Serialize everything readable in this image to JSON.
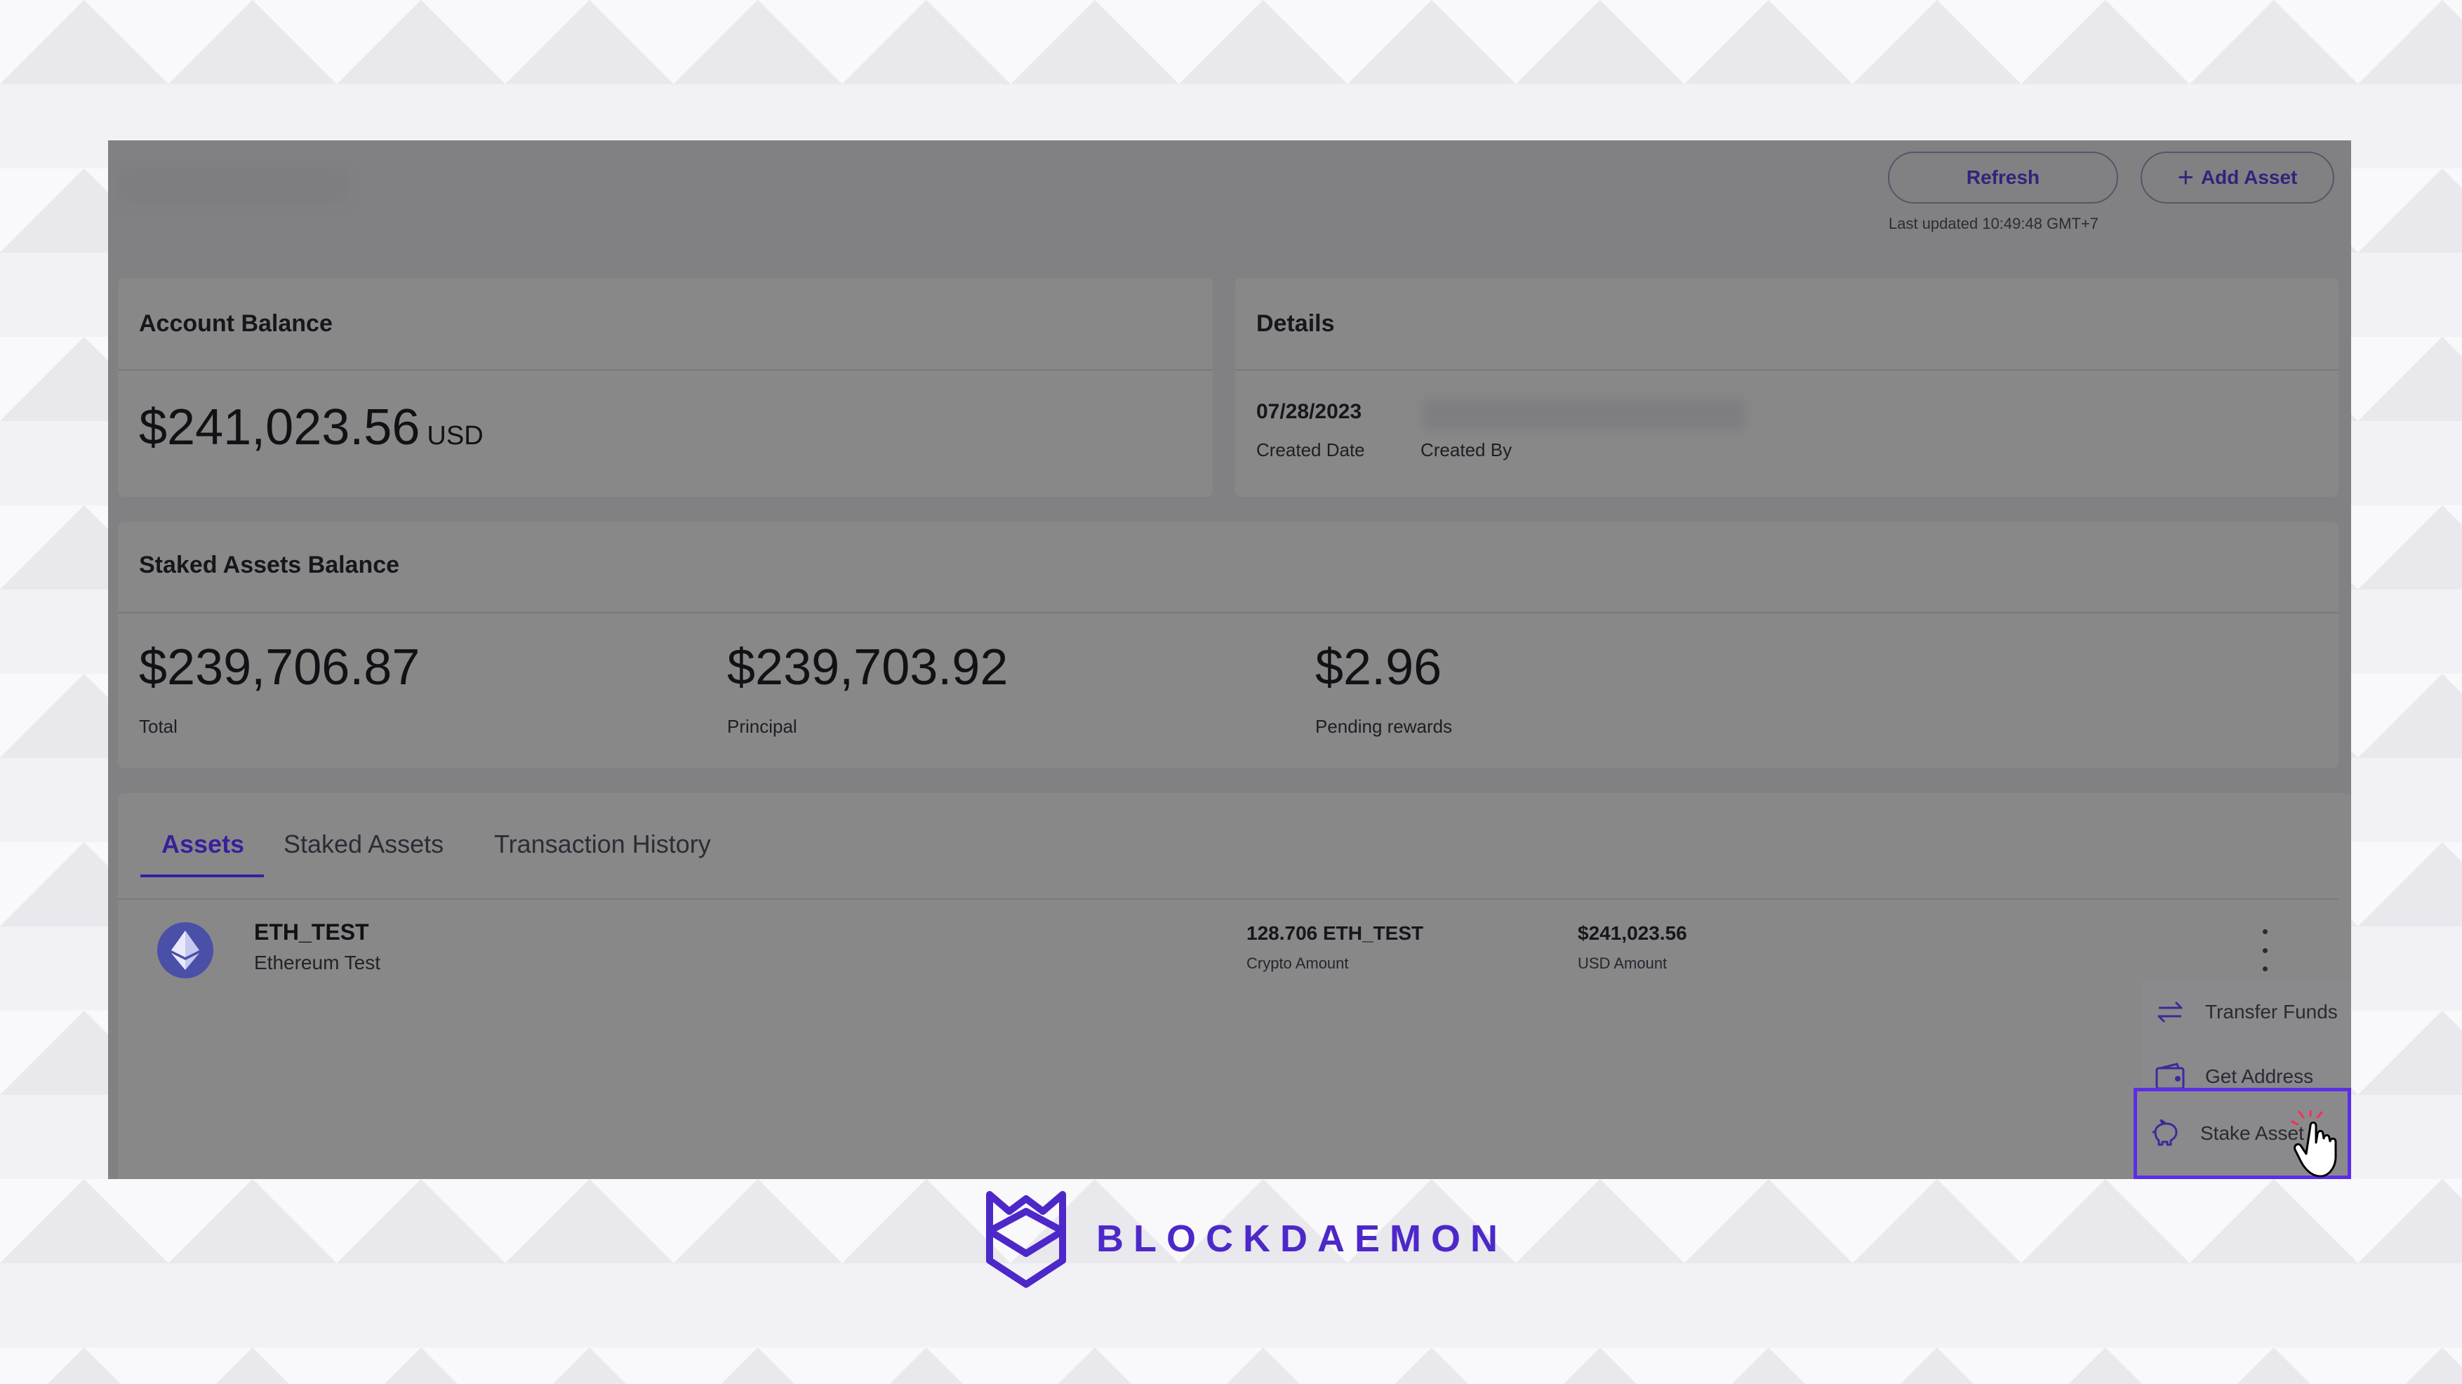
{
  "header": {
    "refresh_label": "Refresh",
    "add_asset_label": "Add Asset",
    "last_updated": "Last updated 10:49:48 GMT+7"
  },
  "account_balance": {
    "title": "Account Balance",
    "amount": "$241,023.56",
    "currency": "USD"
  },
  "details": {
    "title": "Details",
    "created_date_value": "07/28/2023",
    "created_date_label": "Created Date",
    "created_by_label": "Created By"
  },
  "staked": {
    "title": "Staked Assets Balance",
    "total_value": "$239,706.87",
    "total_label": "Total",
    "principal_value": "$239,703.92",
    "principal_label": "Principal",
    "pending_value": "$2.96",
    "pending_label": "Pending rewards"
  },
  "tabs": [
    {
      "label": "Assets",
      "active": true
    },
    {
      "label": "Staked Assets",
      "active": false
    },
    {
      "label": "Transaction History",
      "active": false
    }
  ],
  "asset_row": {
    "icon": "ethereum-icon",
    "name": "ETH_TEST",
    "full_name": "Ethereum Test",
    "crypto_amount": "128.706 ETH_TEST",
    "crypto_amount_label": "Crypto Amount",
    "usd_amount": "$241,023.56",
    "usd_amount_label": "USD Amount"
  },
  "menu": {
    "items": [
      {
        "label": "Transfer Funds",
        "icon": "transfer-icon"
      },
      {
        "label": "Get Address",
        "icon": "wallet-icon"
      },
      {
        "label": "Stake Asset",
        "icon": "piggy-bank-icon"
      }
    ]
  },
  "branding": {
    "name": "BLOCKDAEMON",
    "color": "#4d28c9"
  },
  "colors": {
    "accent": "#5a2ee6",
    "tab_active": "#3a1f9c"
  }
}
